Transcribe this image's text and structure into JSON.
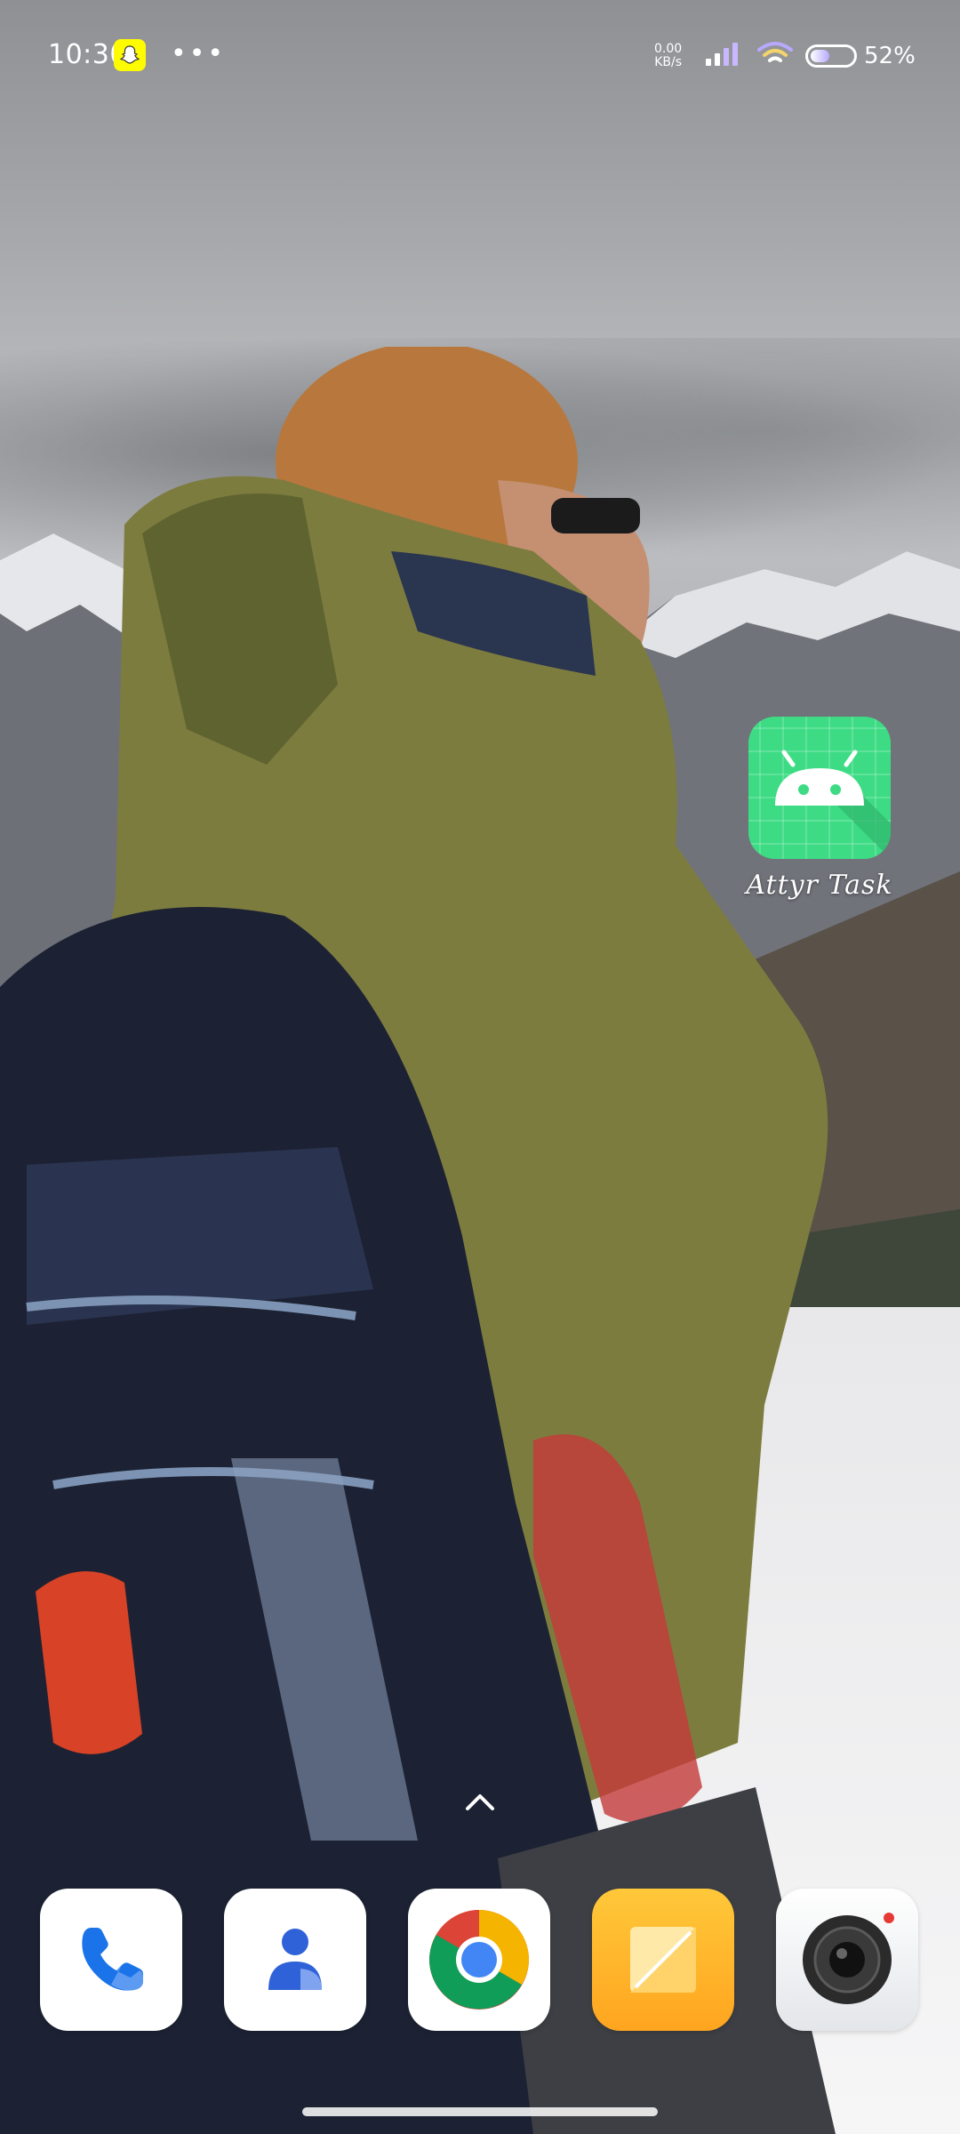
{
  "status_bar": {
    "time": "10:30",
    "notification_icons": [
      "snapchat-icon",
      "more-icon"
    ],
    "more": "•••",
    "net_speed_value": "0.00",
    "net_speed_unit": "KB/s",
    "battery_percent": "52%",
    "battery_level": 0.52
  },
  "home_screen": {
    "app_shortcut": {
      "label": "Attyr Task",
      "icon": "android-robot-icon",
      "icon_color": "#3ddc84"
    }
  },
  "dock": [
    {
      "name": "phone",
      "icon": "phone-icon",
      "color": "#1a73e8"
    },
    {
      "name": "contacts",
      "icon": "contact-icon",
      "color": "#3b6fe0"
    },
    {
      "name": "chrome",
      "icon": "chrome-icon"
    },
    {
      "name": "notes",
      "icon": "notes-icon",
      "color": "#ffb22c"
    },
    {
      "name": "camera",
      "icon": "camera-icon",
      "color": "#222222"
    }
  ]
}
